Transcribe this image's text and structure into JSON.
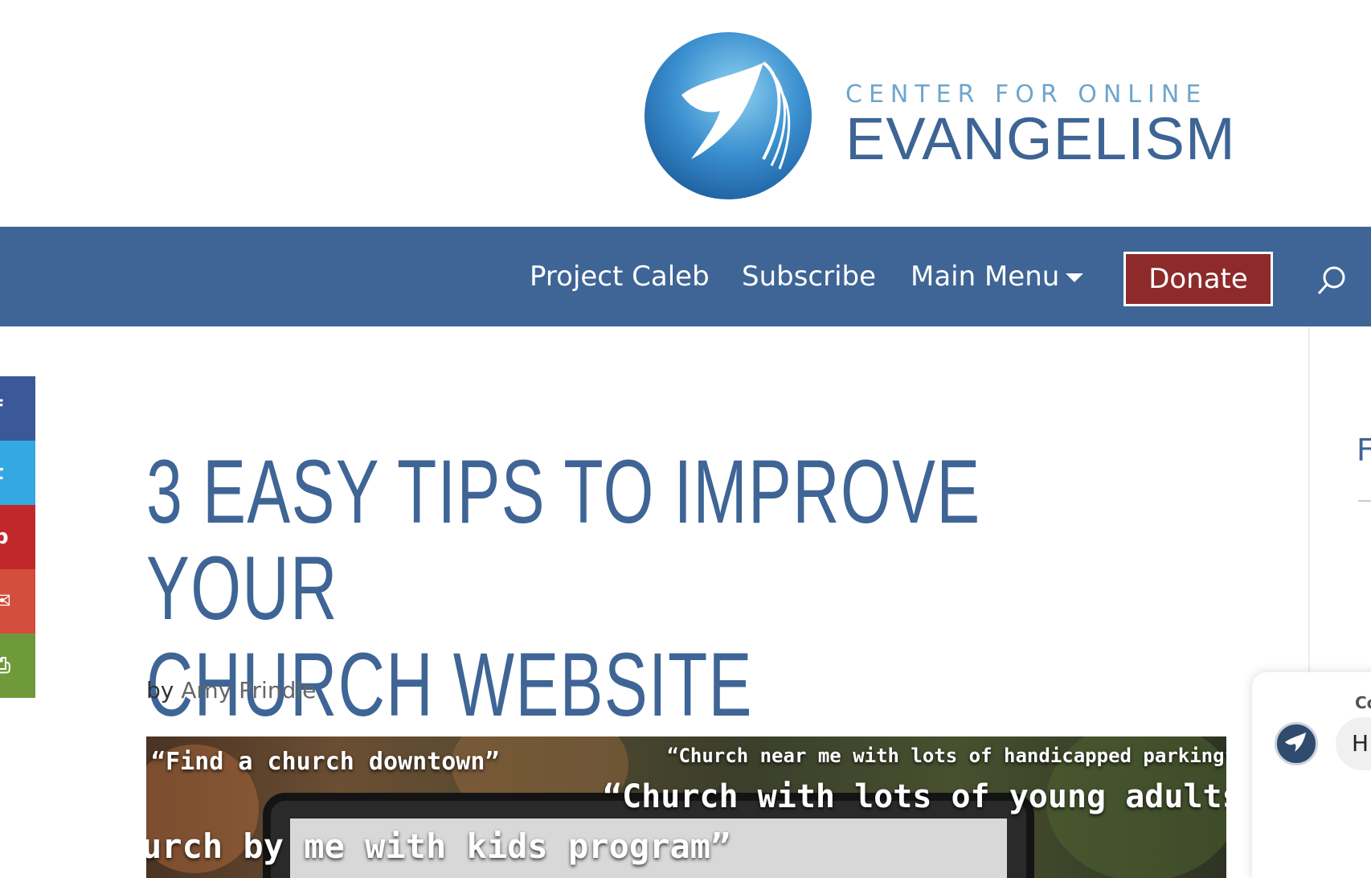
{
  "brand": {
    "line1": "CENTER FOR ONLINE",
    "line2": "EVANGELISM",
    "logo_icon": "dove-globe-icon"
  },
  "nav": {
    "items": [
      {
        "label": "Project Caleb"
      },
      {
        "label": "Subscribe"
      },
      {
        "label": "Main Menu"
      }
    ],
    "donate_label": "Donate",
    "search_icon": "search-icon"
  },
  "share": {
    "buttons": [
      {
        "name": "facebook",
        "glyph": "f",
        "color": "#3b5998"
      },
      {
        "name": "twitter",
        "glyph": "t",
        "color": "#34a8e0"
      },
      {
        "name": "pinterest",
        "glyph": "p",
        "color": "#c1282c"
      },
      {
        "name": "email",
        "glyph": "✉",
        "color": "#d34e3c"
      },
      {
        "name": "print",
        "glyph": "⎙",
        "color": "#6f9a3b"
      }
    ]
  },
  "article": {
    "title_line1": "3 Easy Tips to Improve Your",
    "title_line2": "Church Website",
    "by": "by",
    "author": "Amy Prindle"
  },
  "featured_image": {
    "quote1": "“Find a church downtown”",
    "quote2": "“Church near me with lots of handicapped parking”",
    "quote3": "“Church with lots of young adults",
    "quote4": "urch by me with kids program”"
  },
  "sidebar": {
    "heading": "F"
  },
  "chat": {
    "label": "Co",
    "bubble_text": "H"
  },
  "colors": {
    "nav_bg": "#3e6595",
    "donate_bg": "#8e2a2a",
    "title": "#3e6595"
  }
}
